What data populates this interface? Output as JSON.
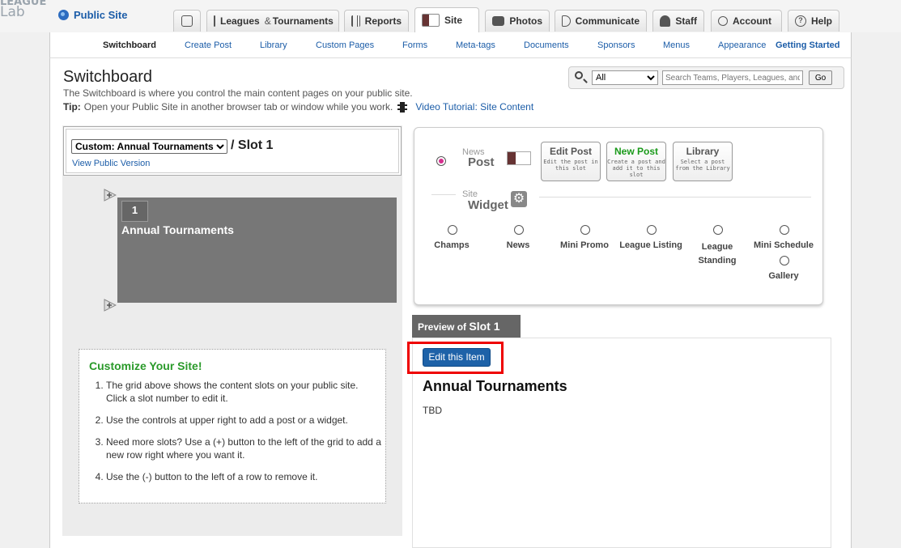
{
  "logo": {
    "line1": "LEAGUE",
    "line2": "Lab"
  },
  "header": {
    "public_site": "Public Site",
    "tabs": [
      {
        "label": "",
        "icon": "checkbox-icon"
      },
      {
        "label": "Leagues",
        "amp": "&",
        "label2": "Tournaments",
        "icon": "clipboard-icon"
      },
      {
        "label": "Reports",
        "icon": "bar-chart-icon"
      },
      {
        "label": "Site",
        "icon": "site-thumbnail-icon"
      },
      {
        "label": "Photos",
        "icon": "camera-icon"
      },
      {
        "label": "Communicate",
        "icon": "megaphone-icon"
      },
      {
        "label": "Staff",
        "icon": "staff-icon"
      },
      {
        "label": "Account",
        "icon": "wrench-icon"
      },
      {
        "label": "Help",
        "icon": "help-icon"
      }
    ]
  },
  "subnav": {
    "items": [
      "Switchboard",
      "Create Post",
      "Library",
      "Custom Pages",
      "Forms",
      "Meta-tags",
      "Documents",
      "Sponsors",
      "Menus",
      "Appearance",
      "Getting Started"
    ]
  },
  "page": {
    "title": "Switchboard",
    "intro": "The Switchboard is where you control the main content pages on your public site.",
    "tip_label": "Tip:",
    "tip_text": "Open your Public Site in another browser tab or window while you work.",
    "tip_link": "Video Tutorial: Site Content"
  },
  "search": {
    "select_value": "All",
    "placeholder": "Search Teams, Players, Leagues, and",
    "go_label": "Go"
  },
  "slot": {
    "select_value": "Custom: Annual Tournaments",
    "label": "/ Slot 1",
    "view_public": "View Public Version",
    "grid_number": "1",
    "grid_title": "Annual Tournaments"
  },
  "customize": {
    "heading": "Customize Your Site!",
    "steps": [
      "The grid above shows the content slots on your public site. Click a slot number to edit it.",
      "Use the controls at upper right to add a post or a widget.",
      "Need more slots? Use a (+) button to the left of the grid to add a new row right where you want it.",
      "Use the (-) button to the left of a row to remove it."
    ]
  },
  "controls": {
    "news_small": "News",
    "news_big": "Post",
    "site_small": "Site",
    "site_big": "Widget",
    "buttons": [
      {
        "title": "Edit Post",
        "desc": "Edit the post in this slot"
      },
      {
        "title": "New Post",
        "desc": "Create a post and add it to this slot"
      },
      {
        "title": "Library",
        "desc": "Select a post from the Library"
      }
    ],
    "widgets": [
      "Champs",
      "News",
      "Mini Promo",
      "League Listing",
      "League Standing",
      "Mini Schedule",
      "Gallery"
    ]
  },
  "preview": {
    "tab_prefix": "Preview of",
    "tab_slot": "Slot 1",
    "edit_button": "Edit this Item",
    "title": "Annual Tournaments",
    "body": "TBD"
  }
}
